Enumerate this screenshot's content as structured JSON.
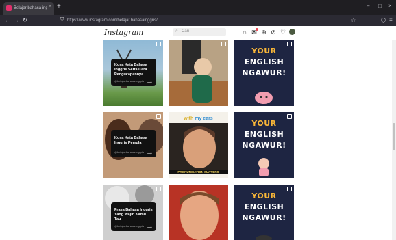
{
  "browser": {
    "tab_title": "Belajar bahasa inggris (@belaj",
    "tab_close": "×",
    "new_tab": "+",
    "url": "https://www.instagram.com/belajar.bahasainggris/",
    "nav": {
      "back": "←",
      "forward": "→",
      "reload": "↻"
    },
    "window": {
      "minimize": "–",
      "maximize": "□",
      "close": "×"
    },
    "right_icons": {
      "extensions": "⬡",
      "menu": "≡",
      "bookmark": "☆",
      "shield": "⛉",
      "lock": "🔒"
    }
  },
  "instagram": {
    "logo": "Instagram",
    "search_placeholder": "Cari",
    "nav_icons": [
      "home-icon",
      "messenger-icon",
      "new-post-icon",
      "explore-icon",
      "activity-icon",
      "profile-avatar"
    ]
  },
  "posts": [
    {
      "type": "card",
      "text": "Kosa Kata Bahasa Inggris Serta Cara Pengucapannya",
      "handle": "@belajar.bahasa.inggris"
    },
    {
      "type": "photo"
    },
    {
      "type": "yen",
      "lines": [
        "YOUR",
        "ENGLISH",
        "NGAWUR!"
      ]
    },
    {
      "type": "card",
      "text": "Kosa Kata Bahasa Inggris Pemula",
      "handle": "@belajar.bahasa.inggris"
    },
    {
      "type": "meme",
      "top_text": [
        "with",
        "my ears"
      ],
      "caption": "PRONUNCIATION MATTERS"
    },
    {
      "type": "yen",
      "lines": [
        "YOUR",
        "ENGLISH",
        "NGAWUR!"
      ]
    },
    {
      "type": "card",
      "text": "Frasa Bahasa Inggris Yang Wajib Kamu Tau",
      "handle": "@belajar.bahasa.inggris"
    },
    {
      "type": "photo"
    },
    {
      "type": "yen",
      "lines": [
        "YOUR",
        "ENGLISH",
        "NGAWUR!"
      ]
    }
  ],
  "colors": {
    "accent": "#f7b538",
    "ig_red": "#ed4956",
    "dark_bg": "#1e2542"
  }
}
